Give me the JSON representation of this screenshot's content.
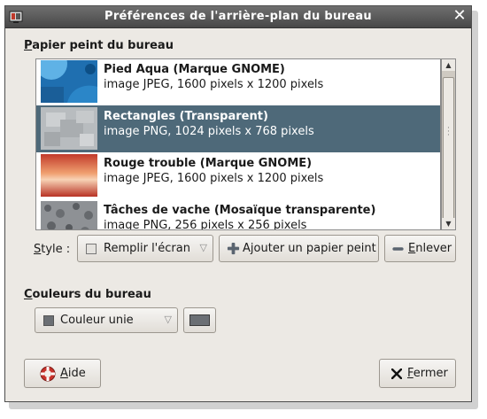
{
  "window": {
    "title": "Préférences de l'arrière-plan du bureau",
    "close_glyph": "✕"
  },
  "wallpaper_section": {
    "title_mnemonic": "P",
    "title_rest": "apier peint du bureau"
  },
  "wallpapers": [
    {
      "name": "Pied Aqua (Marque GNOME)",
      "description": "image JPEG, 1600 pixels x 1200 pixels",
      "selected": false,
      "thumb": "blue-foot"
    },
    {
      "name": "Rectangles (Transparent)",
      "description": "image PNG, 1024 pixels x 768 pixels",
      "selected": true,
      "thumb": "grey-rectangles"
    },
    {
      "name": "Rouge trouble (Marque GNOME)",
      "description": "image JPEG, 1600 pixels x 1200 pixels",
      "selected": false,
      "thumb": "red-blur"
    },
    {
      "name": "Tâches de vache (Mosaïque transparente)",
      "description": "image PNG, 256 pixels x 256 pixels",
      "selected": false,
      "thumb": "grey-spots"
    }
  ],
  "style": {
    "label_mnemonic": "S",
    "label_rest": "tyle :",
    "value": "Remplir l'écran",
    "add_pre": "A",
    "add_mnemonic": "j",
    "add_rest": "outer un papier peint",
    "remove_mnemonic": "E",
    "remove_rest": "nlever"
  },
  "colors_section": {
    "title_mnemonic": "C",
    "title_rest": "ouleurs du bureau",
    "mode": "Couleur unie",
    "color_hex": "#6b6f74"
  },
  "footer": {
    "help_mnemonic": "A",
    "help_rest": "ide",
    "close_mnemonic": "F",
    "close_rest": "ermer"
  },
  "icons": {
    "app": "wallpaper-app-icon",
    "close": "close-icon",
    "add": "plus-icon",
    "remove": "minus-icon",
    "help": "lifebuoy-icon",
    "fermer": "x-icon"
  }
}
